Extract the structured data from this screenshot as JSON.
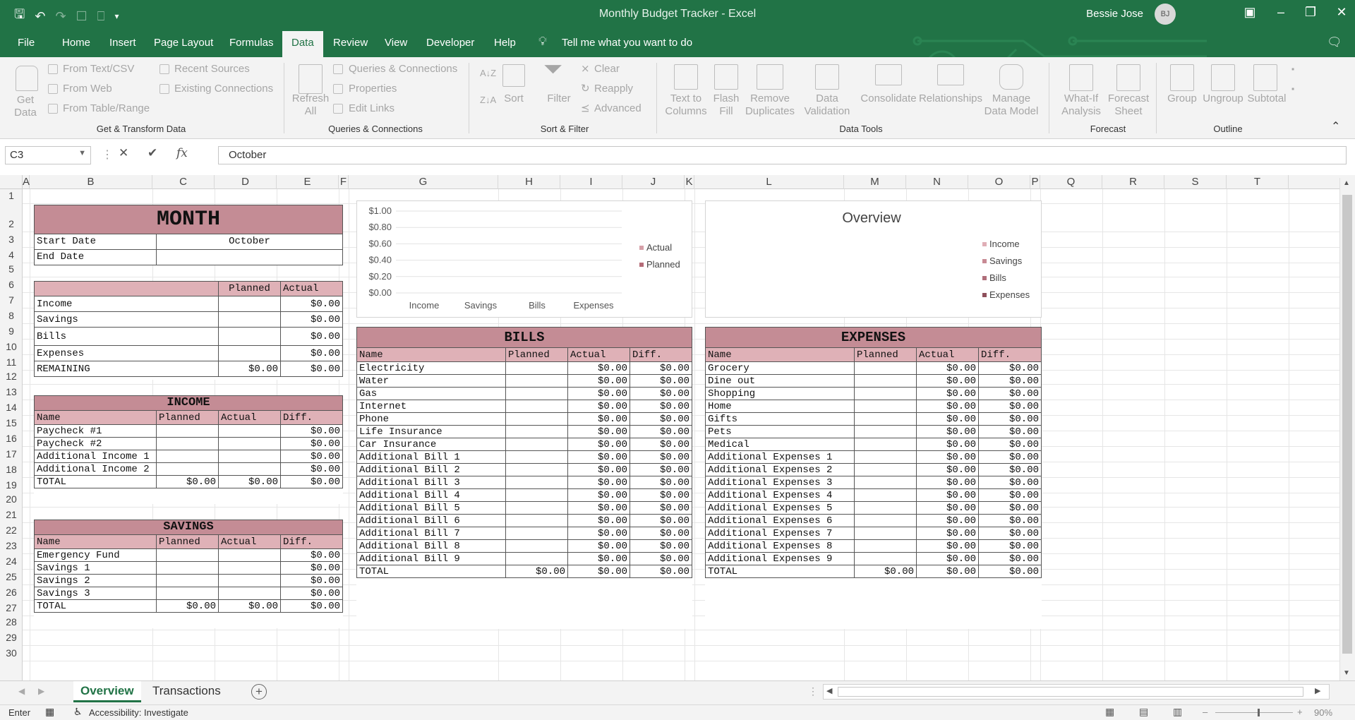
{
  "window": {
    "title": "Monthly Budget Tracker  -  Excel",
    "user_name": "Bessie Jose",
    "user_initials": "BJ"
  },
  "ribbon_tabs": [
    "File",
    "Home",
    "Insert",
    "Page Layout",
    "Formulas",
    "Data",
    "Review",
    "View",
    "Developer",
    "Help"
  ],
  "active_tab": "Data",
  "tell_me": "Tell me what you want to do",
  "ribbon": {
    "get_data": "Get\nData",
    "from_text": "From Text/CSV",
    "from_web": "From Web",
    "from_table": "From Table/Range",
    "recent_sources": "Recent Sources",
    "existing_connections": "Existing Connections",
    "refresh_all": "Refresh\nAll",
    "queries_connections": "Queries & Connections",
    "properties": "Properties",
    "edit_links": "Edit Links",
    "sort": "Sort",
    "filter": "Filter",
    "clear": "Clear",
    "reapply": "Reapply",
    "advanced": "Advanced",
    "text_to_columns": "Text to\nColumns",
    "flash_fill": "Flash\nFill",
    "remove_duplicates": "Remove\nDuplicates",
    "data_validation": "Data\nValidation",
    "consolidate": "Consolidate",
    "relationships": "Relationships",
    "manage_data_model": "Manage\nData Model",
    "what_if": "What-If\nAnalysis",
    "forecast_sheet": "Forecast\nSheet",
    "group": "Group",
    "ungroup": "Ungroup",
    "subtotal": "Subtotal",
    "groups": {
      "get_transform": "Get & Transform Data",
      "queries": "Queries & Connections",
      "sort_filter": "Sort & Filter",
      "data_tools": "Data Tools",
      "forecast": "Forecast",
      "outline": "Outline"
    }
  },
  "formula_bar": {
    "name_box": "C3",
    "formula": "October"
  },
  "columns": [
    "A",
    "B",
    "C",
    "D",
    "E",
    "F",
    "G",
    "H",
    "I",
    "J",
    "K",
    "L",
    "M",
    "N",
    "O",
    "P",
    "Q",
    "R",
    "S",
    "T"
  ],
  "rows": [
    "1",
    "2",
    "3",
    "4",
    "5",
    "6",
    "7",
    "8",
    "9",
    "10",
    "11",
    "12",
    "13",
    "14",
    "15",
    "16",
    "17",
    "18",
    "19",
    "20",
    "21",
    "22",
    "23",
    "24",
    "25",
    "26",
    "27",
    "28",
    "29",
    "30"
  ],
  "month": {
    "title": "MONTH",
    "start_label": "Start Date",
    "start_value": "October",
    "end_label": "End Date"
  },
  "summary": {
    "headers": [
      "Planned",
      "Actual"
    ],
    "rows": [
      [
        "Income",
        "",
        "$0.00"
      ],
      [
        "Savings",
        "",
        "$0.00"
      ],
      [
        "Bills",
        "",
        "$0.00"
      ],
      [
        "Expenses",
        "",
        "$0.00"
      ],
      [
        "REMAINING",
        "$0.00",
        "$0.00"
      ]
    ]
  },
  "income": {
    "title": "INCOME",
    "headers": [
      "Name",
      "Planned",
      "Actual",
      "Diff."
    ],
    "rows": [
      [
        "Paycheck #1",
        "",
        "",
        "$0.00"
      ],
      [
        "Paycheck #2",
        "",
        "",
        "$0.00"
      ],
      [
        "Additional Income 1",
        "",
        "",
        "$0.00"
      ],
      [
        "Additional Income 2",
        "",
        "",
        "$0.00"
      ],
      [
        "TOTAL",
        "$0.00",
        "$0.00",
        "$0.00"
      ]
    ]
  },
  "savings": {
    "title": "SAVINGS",
    "headers": [
      "Name",
      "Planned",
      "Actual",
      "Diff."
    ],
    "rows": [
      [
        "Emergency Fund",
        "",
        "",
        "$0.00"
      ],
      [
        "Savings 1",
        "",
        "",
        "$0.00"
      ],
      [
        "Savings 2",
        "",
        "",
        "$0.00"
      ],
      [
        "Savings 3",
        "",
        "",
        "$0.00"
      ],
      [
        "TOTAL",
        "$0.00",
        "$0.00",
        "$0.00"
      ]
    ]
  },
  "bills": {
    "title": "BILLS",
    "headers": [
      "Name",
      "Planned",
      "Actual",
      "Diff."
    ],
    "rows": [
      [
        "Electricity",
        "",
        "$0.00",
        "$0.00"
      ],
      [
        "Water",
        "",
        "$0.00",
        "$0.00"
      ],
      [
        "Gas",
        "",
        "$0.00",
        "$0.00"
      ],
      [
        "Internet",
        "",
        "$0.00",
        "$0.00"
      ],
      [
        "Phone",
        "",
        "$0.00",
        "$0.00"
      ],
      [
        "Life Insurance",
        "",
        "$0.00",
        "$0.00"
      ],
      [
        "Car Insurance",
        "",
        "$0.00",
        "$0.00"
      ],
      [
        "Additional Bill 1",
        "",
        "$0.00",
        "$0.00"
      ],
      [
        "Additional Bill 2",
        "",
        "$0.00",
        "$0.00"
      ],
      [
        "Additional Bill 3",
        "",
        "$0.00",
        "$0.00"
      ],
      [
        "Additional Bill 4",
        "",
        "$0.00",
        "$0.00"
      ],
      [
        "Additional Bill 5",
        "",
        "$0.00",
        "$0.00"
      ],
      [
        "Additional Bill 6",
        "",
        "$0.00",
        "$0.00"
      ],
      [
        "Additional Bill 7",
        "",
        "$0.00",
        "$0.00"
      ],
      [
        "Additional Bill 8",
        "",
        "$0.00",
        "$0.00"
      ],
      [
        "Additional Bill 9",
        "",
        "$0.00",
        "$0.00"
      ],
      [
        "TOTAL",
        "$0.00",
        "$0.00",
        "$0.00"
      ]
    ]
  },
  "expenses": {
    "title": "EXPENSES",
    "headers": [
      "Name",
      "Planned",
      "Actual",
      "Diff."
    ],
    "rows": [
      [
        "Grocery",
        "",
        "$0.00",
        "$0.00"
      ],
      [
        "Dine out",
        "",
        "$0.00",
        "$0.00"
      ],
      [
        "Shopping",
        "",
        "$0.00",
        "$0.00"
      ],
      [
        "Home",
        "",
        "$0.00",
        "$0.00"
      ],
      [
        "Gifts",
        "",
        "$0.00",
        "$0.00"
      ],
      [
        "Pets",
        "",
        "$0.00",
        "$0.00"
      ],
      [
        "Medical",
        "",
        "$0.00",
        "$0.00"
      ],
      [
        "Additional Expenses 1",
        "",
        "$0.00",
        "$0.00"
      ],
      [
        "Additional Expenses 2",
        "",
        "$0.00",
        "$0.00"
      ],
      [
        "Additional Expenses 3",
        "",
        "$0.00",
        "$0.00"
      ],
      [
        "Additional Expenses 4",
        "",
        "$0.00",
        "$0.00"
      ],
      [
        "Additional Expenses 5",
        "",
        "$0.00",
        "$0.00"
      ],
      [
        "Additional Expenses 6",
        "",
        "$0.00",
        "$0.00"
      ],
      [
        "Additional Expenses 7",
        "",
        "$0.00",
        "$0.00"
      ],
      [
        "Additional Expenses 8",
        "",
        "$0.00",
        "$0.00"
      ],
      [
        "Additional Expenses 9",
        "",
        "$0.00",
        "$0.00"
      ],
      [
        "TOTAL",
        "$0.00",
        "$0.00",
        "$0.00"
      ]
    ]
  },
  "chart_data": [
    {
      "type": "bar",
      "categories": [
        "Income",
        "Savings",
        "Bills",
        "Expenses"
      ],
      "series": [
        {
          "name": "Actual",
          "values": [
            0,
            0,
            0,
            0
          ]
        },
        {
          "name": "Planned",
          "values": [
            0,
            0,
            0,
            0
          ]
        }
      ],
      "yticks": [
        "$1.00",
        "$0.80",
        "$0.60",
        "$0.40",
        "$0.20",
        "$0.00"
      ],
      "ylim": [
        0,
        1
      ],
      "legend": "right"
    },
    {
      "type": "pie",
      "title": "Overview",
      "categories": [
        "Income",
        "Savings",
        "Bills",
        "Expenses"
      ],
      "values": [
        0,
        0,
        0,
        0
      ],
      "legend": "right"
    }
  ],
  "sheet_tabs": [
    "Overview",
    "Transactions"
  ],
  "active_sheet": "Overview",
  "status": {
    "mode": "Enter",
    "accessibility": "Accessibility: Investigate",
    "zoom": "90%"
  },
  "colors": {
    "excel_green": "#217346",
    "header_fill": "#c48c95",
    "subheader_fill": "#dfb1b7"
  }
}
